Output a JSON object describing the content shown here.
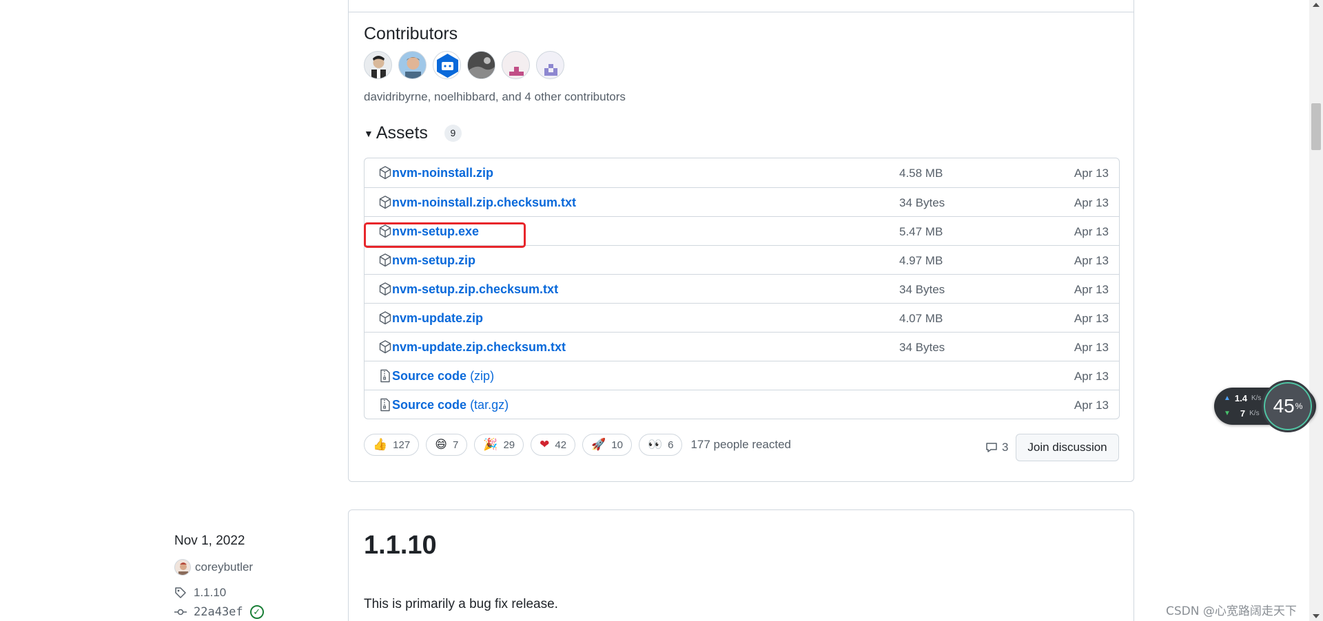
{
  "contributors": {
    "title": "Contributors",
    "summary": "davidribyrne, noelhibbard, and 4 other contributors",
    "avatars": [
      "avatar-davidribyrne",
      "avatar-noelhibbard",
      "avatar-bot",
      "avatar-contributor-4",
      "avatar-contributor-5",
      "avatar-contributor-6"
    ]
  },
  "assets": {
    "title": "Assets",
    "count": "9",
    "items": [
      {
        "name": "nvm-noinstall.zip",
        "suffix": "",
        "size": "4.58 MB",
        "date": "Apr 13",
        "icon": "package-icon"
      },
      {
        "name": "nvm-noinstall.zip.checksum.txt",
        "suffix": "",
        "size": "34 Bytes",
        "date": "Apr 13",
        "icon": "package-icon"
      },
      {
        "name": "nvm-setup.exe",
        "suffix": "",
        "size": "5.47 MB",
        "date": "Apr 13",
        "icon": "package-icon"
      },
      {
        "name": "nvm-setup.zip",
        "suffix": "",
        "size": "4.97 MB",
        "date": "Apr 13",
        "icon": "package-icon"
      },
      {
        "name": "nvm-setup.zip.checksum.txt",
        "suffix": "",
        "size": "34 Bytes",
        "date": "Apr 13",
        "icon": "package-icon"
      },
      {
        "name": "nvm-update.zip",
        "suffix": "",
        "size": "4.07 MB",
        "date": "Apr 13",
        "icon": "package-icon"
      },
      {
        "name": "nvm-update.zip.checksum.txt",
        "suffix": "",
        "size": "34 Bytes",
        "date": "Apr 13",
        "icon": "package-icon"
      },
      {
        "name": "Source code",
        "suffix": "(zip)",
        "size": "",
        "date": "Apr 13",
        "icon": "file-zip-icon"
      },
      {
        "name": "Source code",
        "suffix": "(tar.gz)",
        "size": "",
        "date": "Apr 13",
        "icon": "file-zip-icon"
      }
    ]
  },
  "reactions": {
    "items": [
      {
        "emoji": "👍",
        "count": "127",
        "name": "thumbs-up"
      },
      {
        "emoji": "😄",
        "count": "7",
        "name": "laugh"
      },
      {
        "emoji": "🎉",
        "count": "29",
        "name": "hooray"
      },
      {
        "emoji": "❤",
        "count": "42",
        "name": "heart"
      },
      {
        "emoji": "🚀",
        "count": "10",
        "name": "rocket"
      },
      {
        "emoji": "👀",
        "count": "6",
        "name": "eyes"
      }
    ],
    "summary": "177 people reacted"
  },
  "discussion": {
    "comment_count": "3",
    "join_label": "Join discussion"
  },
  "next_release": {
    "date": "Nov 1, 2022",
    "author": "coreybutler",
    "tag": "1.1.10",
    "commit": "22a43ef",
    "title": "1.1.10",
    "description": "This is primarily a bug fix release."
  },
  "network_widget": {
    "upload_value": "1.4",
    "upload_unit": "K/s",
    "download_value": "7",
    "download_unit": "K/s",
    "percent": "45",
    "percent_sign": "%"
  },
  "watermark": "CSDN @心宽路阔走天下",
  "colors": {
    "link": "#0969da",
    "highlight_box": "#e8262b",
    "border": "#d0d7de"
  }
}
